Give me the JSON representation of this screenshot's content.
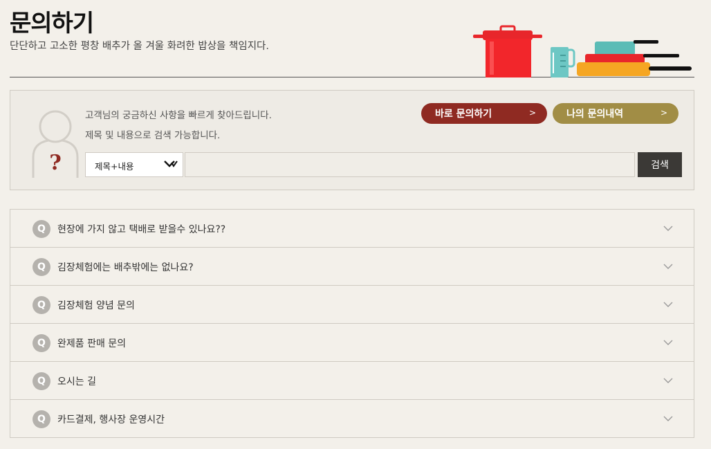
{
  "header": {
    "title": "문의하기",
    "subtitle": "단단하고 고소한 평창 배추가 올 겨울 화려한 밥상을 책임지다."
  },
  "search": {
    "desc_line1": "고객님의 궁금하신 사항을 빠르게 찾아드립니다.",
    "desc_line2": "제목 및 내용으로 검색 가능합니다.",
    "direct_inquiry_label": "바로 문의하기",
    "my_inquiries_label": "나의 문의내역",
    "select_value": "제목+내용",
    "input_value": "",
    "search_button_label": "검색",
    "icon_question": "?"
  },
  "faq": {
    "badge": "Q",
    "items": [
      {
        "question": "현장에 가지 않고 택배로 받을수 있나요??"
      },
      {
        "question": "김장체험에는 배추밖에는 없나요?"
      },
      {
        "question": "김장체험 양념 문의"
      },
      {
        "question": "완제품 판매 문의"
      },
      {
        "question": "오시는 길"
      },
      {
        "question": "카드결제, 행사장 운영시간"
      }
    ]
  },
  "colors": {
    "background": "#f3f0ea",
    "direct_button": "#8f2a22",
    "my_button": "#a18d45",
    "search_button": "#3b3936",
    "badge": "#b5b2ad"
  }
}
